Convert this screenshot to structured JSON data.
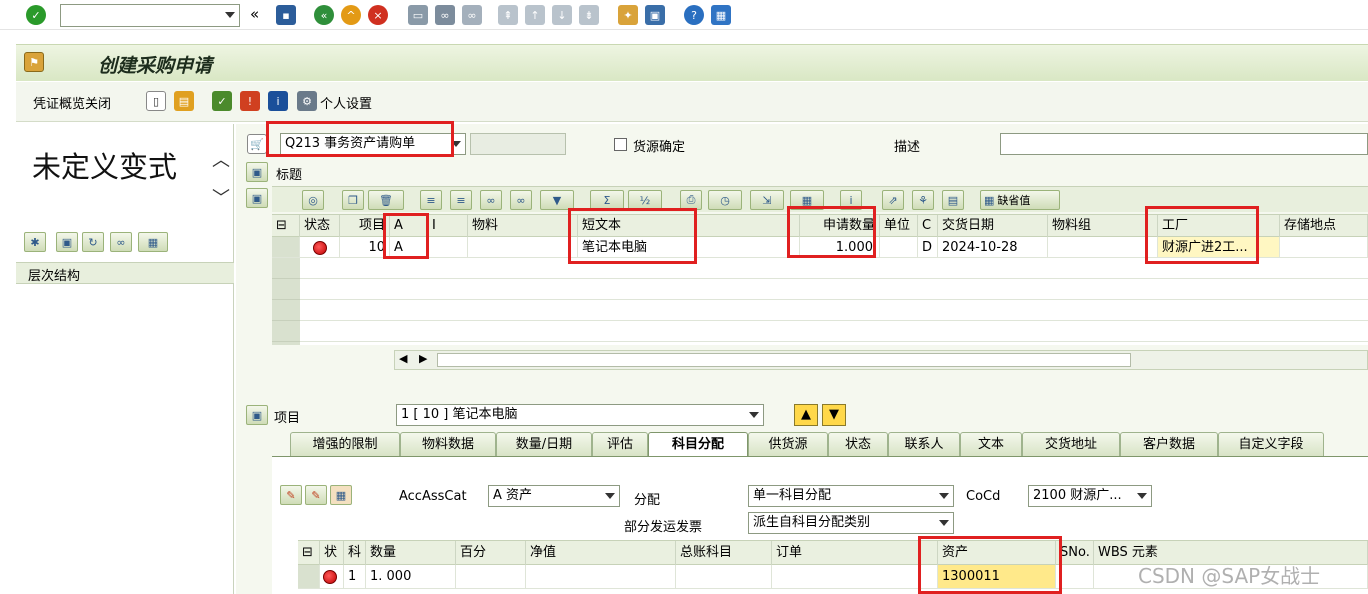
{
  "topbar": {
    "command_value": ""
  },
  "title": "创建采购申请",
  "app_toolbar": {
    "close_label": "凭证概览关闭",
    "personal_settings": "个人设置"
  },
  "left_panel": {
    "variant_title": "未定义变式",
    "hierarchy_label": "层次结构"
  },
  "header": {
    "doc_type": "Q213 事务资产请购单",
    "source_confirm": "货源确定",
    "description_label": "描述",
    "title_label": "标题",
    "default_label": "缺省值"
  },
  "item_table": {
    "columns": [
      "状态",
      "项目",
      "A",
      "I",
      "物料",
      "短文本",
      "申请数量",
      "单位",
      "C",
      "交货日期",
      "物料组",
      "工厂",
      "存储地点"
    ],
    "row": {
      "item": "10",
      "acct": "A",
      "short_text": "笔记本电脑",
      "qty": "1.000",
      "c": "D",
      "date": "2024-10-28",
      "plant": "财源广进2工..."
    }
  },
  "item_detail": {
    "label": "项目",
    "selected": "1 [ 10 ] 笔记本电脑",
    "tabs": [
      "增强的限制",
      "物料数据",
      "数量/日期",
      "评估",
      "科目分配",
      "供货源",
      "状态",
      "联系人",
      "文本",
      "交货地址",
      "客户数据",
      "自定义字段"
    ],
    "active_tab": "科目分配"
  },
  "acct": {
    "accasscat_label": "AccAssCat",
    "accasscat_value": "A 资产",
    "distribution_label": "分配",
    "distribution_value": "单一科目分配",
    "cocd_label": "CoCd",
    "cocd_value": "2100 财源广...",
    "partial_label": "部分发运发票",
    "partial_value": "派生自科目分配类别",
    "columns": [
      "状",
      "科",
      "数量",
      "百分",
      "净值",
      "总账科目",
      "订单",
      "资产",
      "SNo.",
      "WBS 元素"
    ],
    "row": {
      "k": "1",
      "qty": "1. 000",
      "asset": "1300011"
    }
  },
  "watermark": "CSDN @SAP女战士"
}
